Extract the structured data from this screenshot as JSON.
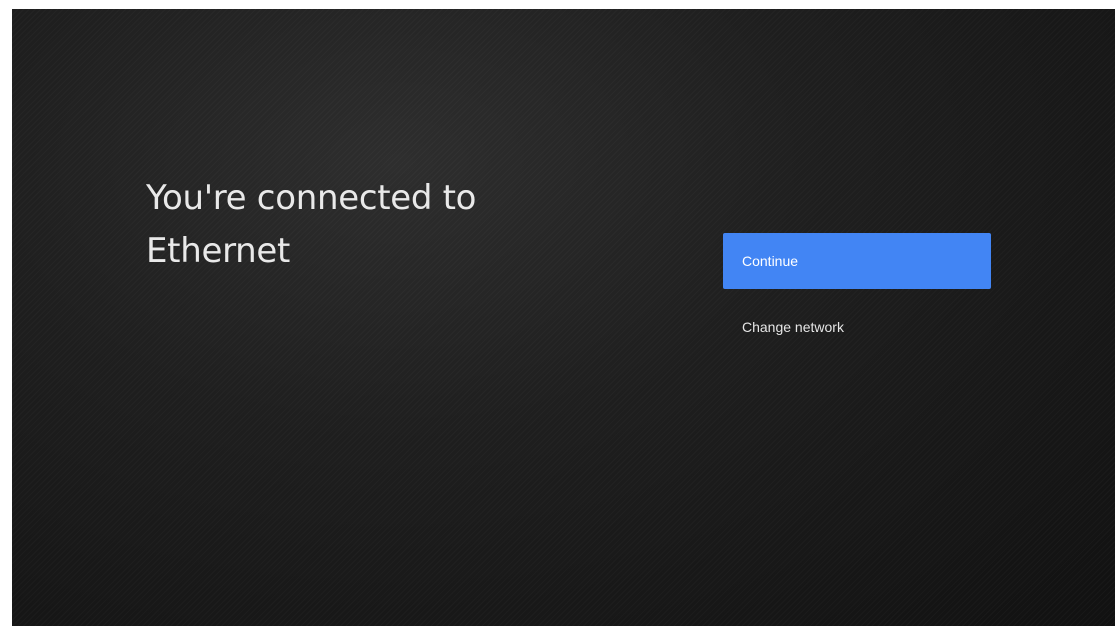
{
  "setup": {
    "title_line1": "You're connected to",
    "title_line2": "Ethernet"
  },
  "actions": {
    "continue_label": "Continue",
    "change_network_label": "Change network"
  },
  "colors": {
    "accent": "#4285f4",
    "background": "#161616",
    "text": "#e9e9e9"
  }
}
